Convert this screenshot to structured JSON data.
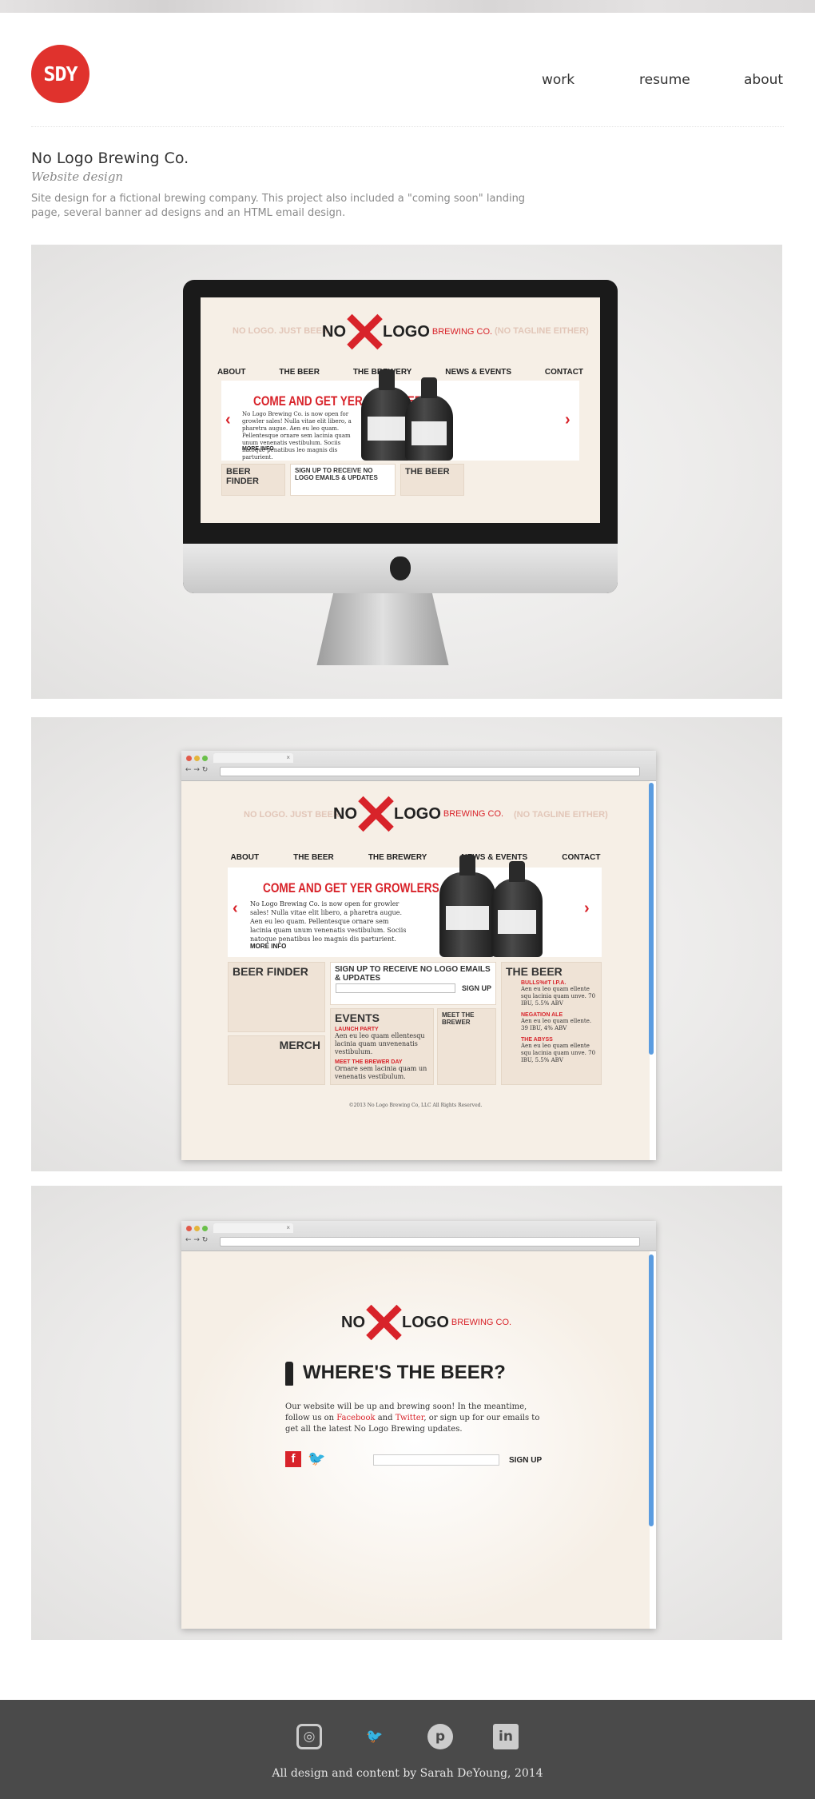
{
  "site": {
    "logo": "SDY",
    "nav": [
      "work",
      "resume",
      "about"
    ]
  },
  "project": {
    "title": "No Logo Brewing Co.",
    "subtitle": "Website design",
    "description": "Site design for a fictional brewing company. This project also included a \"coming soon\" landing page, several banner ad designs and an HTML email design."
  },
  "mock": {
    "brand_no": "NO",
    "brand_logo": "LOGO",
    "brand_co": "BREWING CO.",
    "tag_left": "NO LOGO. JUST BEER.",
    "tag_right": "(NO TAGLINE EITHER)",
    "nav": [
      "ABOUT",
      "THE BEER",
      "THE BREWERY",
      "NEWS & EVENTS",
      "CONTACT"
    ],
    "hero_title": "COME AND GET YER GROWLERS",
    "hero_text": "No Logo Brewing Co. is now open for growler sales! Nulla vitae elit libero, a pharetra augue. Aen eu leo quam. Pellentesque ornare sem lacinia quam unum venenatis vestibulum. Sociis natoque penatibus leo magnis dis parturient.",
    "more": "MORE INFO",
    "beer_finder": "BEER FINDER",
    "signup_title": "SIGN UP TO RECEIVE NO LOGO EMAILS & UPDATES",
    "the_beer": "THE BEER",
    "signup_btn": "SIGN UP",
    "merch": "MERCH",
    "events": "EVENTS",
    "meet": "MEET THE BREWER",
    "event1": "LAUNCH PARTY",
    "event1_text": "Aen eu leo quam ellentesqu lacinia quam unvenenatis vestibulum.",
    "event2": "MEET THE BREWER DAY",
    "event2_text": "Ornare sem lacinia quam un venenatis vestibulum.",
    "beer1": "BULLS%#T I.P.A.",
    "beer1_text": "Aen eu leo quam ellente squ lacinia quam unve. 70 IBU, 5.5% ABV",
    "beer2": "NEGATION ALE",
    "beer2_text": "Aen eu leo quam ellente. 39 IBU, 4% ABV",
    "beer3": "THE ABYSS",
    "beer3_text": "Aen eu leo quam ellente squ lacinia quam unve. 70 IBU, 5.5% ABV",
    "copyright": "©2013 No Logo Brewing Co, LLC All Rights Reserved."
  },
  "landing": {
    "heading": "WHERE'S THE BEER?",
    "text_pre": "Our website will be up and brewing soon! In the meantime, follow us on ",
    "facebook": "Facebook",
    "and": " and ",
    "twitter": "Twitter",
    "text_post": ", or sign up for our emails to get all the latest No Logo Brewing updates.",
    "signup": "SIGN UP"
  },
  "footer": {
    "credit": "All design and content by Sarah DeYoung, 2014",
    "icons": [
      "instagram-icon",
      "twitter-icon",
      "pinterest-icon",
      "linkedin-icon"
    ]
  },
  "colors": {
    "accent": "#e0322d",
    "brand_red": "#d8232a",
    "footer_bg": "#4a4a4a"
  }
}
